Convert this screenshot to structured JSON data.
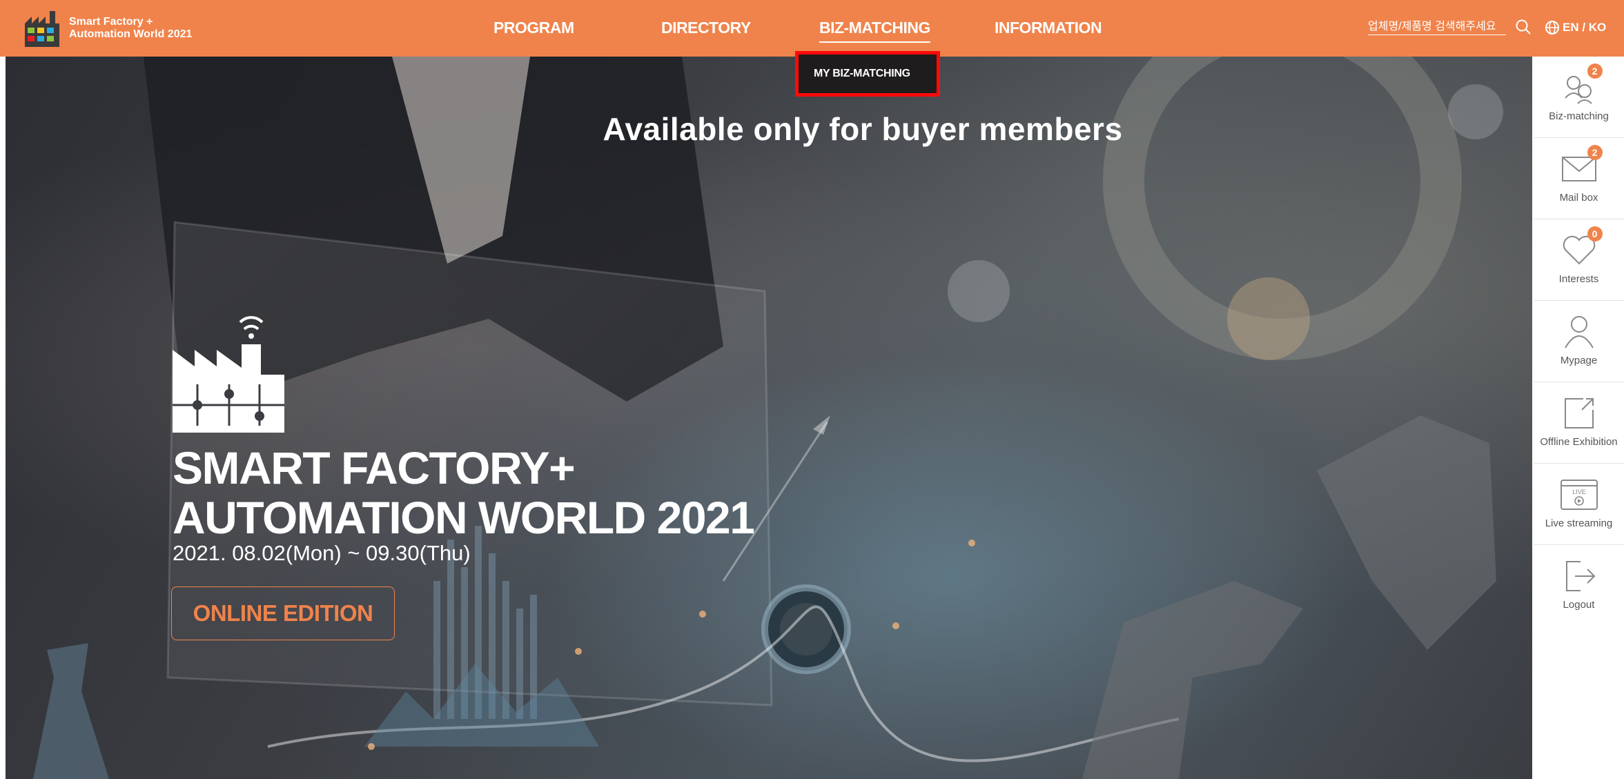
{
  "header": {
    "logo_line1": "Smart Factory +",
    "logo_line2": "Automation World 2021",
    "nav": [
      {
        "label": "PROGRAM"
      },
      {
        "label": "DIRECTORY"
      },
      {
        "label": "BIZ-MATCHING"
      },
      {
        "label": "INFORMATION"
      }
    ],
    "active_nav": "BIZ-MATCHING",
    "search_placeholder": "업체명/제품명 검색해주세요",
    "lang_label": "EN / KO"
  },
  "dropdown": {
    "item_label": "MY BIZ-MATCHING",
    "highlight_color": "#ff0a0a"
  },
  "notice": "Available only for buyer members",
  "hero": {
    "title_line1": "SMART FACTORY+",
    "title_line2": "AUTOMATION WORLD 2021",
    "date": "2021. 08.02(Mon) ~ 09.30(Thu)",
    "edition_button": "ONLINE EDITION"
  },
  "sidebar": {
    "items": [
      {
        "label": "Biz-matching",
        "icon": "biz-matching-icon",
        "badge": "2"
      },
      {
        "label": "Mail box",
        "icon": "mail-icon",
        "badge": "2"
      },
      {
        "label": "Interests",
        "icon": "heart-icon",
        "badge": "0"
      },
      {
        "label": "Mypage",
        "icon": "user-icon"
      },
      {
        "label": "Offline Exhibition",
        "icon": "external-link-icon"
      },
      {
        "label": "Live streaming",
        "icon": "live-icon",
        "icon_text": "LIVE"
      },
      {
        "label": "Logout",
        "icon": "logout-icon"
      }
    ]
  },
  "colors": {
    "brand_orange": "#f0834b",
    "header_text": "#ffffff"
  }
}
